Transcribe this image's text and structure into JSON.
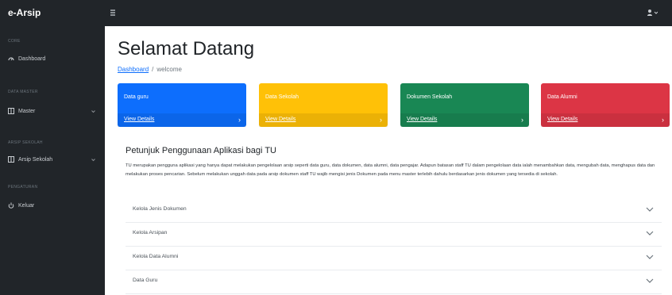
{
  "topbar": {
    "brand": "e-Arsip"
  },
  "sidebar": {
    "sections": [
      {
        "heading": "CORE",
        "items": [
          {
            "label": "Dashboard",
            "icon": "gauge-icon",
            "has_children": false
          }
        ]
      },
      {
        "heading": "DATA MASTER",
        "items": [
          {
            "label": "Master",
            "icon": "columns-icon",
            "has_children": true
          }
        ]
      },
      {
        "heading": "ARSIP SEKOLAH",
        "items": [
          {
            "label": "Arsip Sekolah",
            "icon": "columns-icon",
            "has_children": true
          }
        ]
      },
      {
        "heading": "PENGATURAN",
        "items": [
          {
            "label": "Keluar",
            "icon": "power-icon",
            "has_children": false
          }
        ]
      }
    ]
  },
  "main": {
    "title": "Selamat Datang",
    "breadcrumb": {
      "link": "Dashboard",
      "current": "welcome"
    },
    "cards": [
      {
        "label": "Data guru",
        "link": "View Details",
        "color": "#0d6efd"
      },
      {
        "label": "Data Sekolah",
        "link": "View Details",
        "color": "#ffc107"
      },
      {
        "label": "Dokumen Sekolah",
        "link": "View Details",
        "color": "#198754"
      },
      {
        "label": "Data Alumni",
        "link": "View Details",
        "color": "#dc3545"
      }
    ],
    "guide": {
      "title": "Petunjuk Penggunaan Aplikasi bagi TU",
      "paragraph": "TU merupakan pengguna aplikasi yang hanya dapat melakukan pengelolaan arsip seperti data guru, data dokumen, data alumni, data pengajar. Adapun batasan staff TU dalam pengelolaan data ialah menambahkan data, mengubah data, menghapus data dan melakukan proses pencarian. Sebelum melakukan unggah data pada arsip dokumen staff TU wajib mengisi jenis Dokumen pada menu master terlebih dahulu berdasarkan jenis dokumen yang tersedia di sekolah.",
      "accordion": [
        {
          "label": "Kelola Jenis Dokumen"
        },
        {
          "label": "Kelola Arsipan"
        },
        {
          "label": "Kelola Data Alumni"
        },
        {
          "label": "Data Guru"
        }
      ]
    }
  },
  "colors": {
    "sidebar_bg": "#212529",
    "link": "#0d6efd"
  }
}
